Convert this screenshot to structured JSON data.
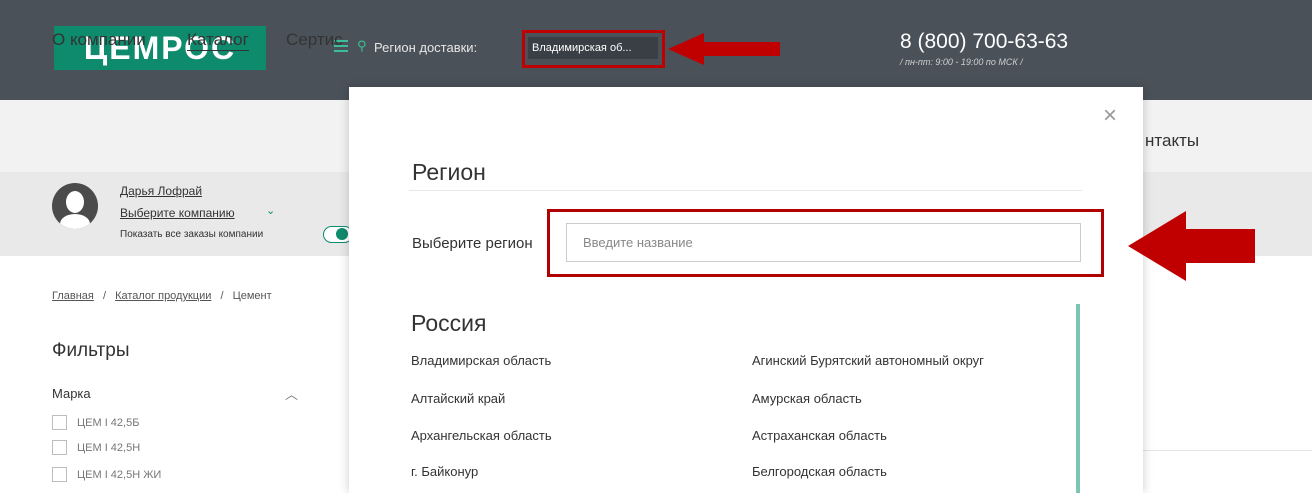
{
  "header": {
    "logo": "ЦЕМРОС",
    "region_label": "Регион доставки:",
    "region_value": "Владимирская об...",
    "phone": "8 (800) 700-63-63",
    "hours": "/ пн-пт: 9:00 - 19:00 по МСК /"
  },
  "nav": {
    "items": [
      "О компании",
      "Каталог",
      "Сертис"
    ],
    "right_item": "нтакты"
  },
  "user": {
    "name": "Дарья Лофрай",
    "company_link": "Выберите компанию",
    "show_orders": "Показать все заказы компании"
  },
  "breadcrumb": [
    "Главная",
    "Каталог продукции",
    "Цемент"
  ],
  "breadcrumb_sep": "/",
  "filters": {
    "title": "Фильтры",
    "brand_title": "Марка",
    "options": [
      "ЦЕМ I 42,5Б",
      "ЦЕМ I 42,5Н",
      "ЦЕМ I 42,5Н ЖИ"
    ]
  },
  "modal": {
    "close": "×",
    "title": "Регион",
    "choose_label": "Выберите регион",
    "search_placeholder": "Введите название",
    "country": "Россия",
    "regions_left": [
      "Владимирская область",
      "Алтайский край",
      "Архангельская область",
      "г. Байконур"
    ],
    "regions_right": [
      "Агинский Бурятский автономный округ",
      "Амурская область",
      "Астраханская область",
      "Белгородская область"
    ]
  },
  "colors": {
    "header_bg": "#4b5159",
    "brand_green": "#0e8a6d",
    "highlight_red": "#c00000"
  }
}
